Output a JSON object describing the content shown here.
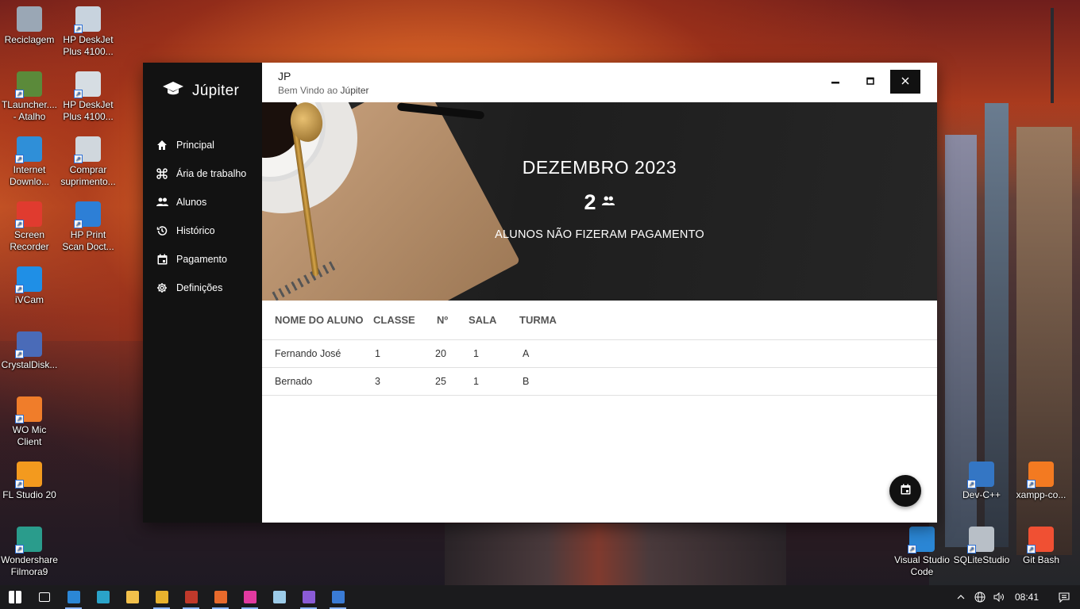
{
  "desktop": {
    "icons_left": [
      {
        "label": "Reciclagem",
        "icon": "recycle-bin-icon",
        "color": "#9aa7b5"
      },
      {
        "label": "HP DeskJet Plus 4100...",
        "icon": "printer-icon",
        "color": "#c8d3de"
      },
      {
        "label": "TLauncher.... - Atalho",
        "icon": "minecraft-block-icon",
        "color": "#5b8a3a"
      },
      {
        "label": "HP DeskJet Plus 4100...",
        "icon": "printer-icon",
        "color": "#d6dde3"
      },
      {
        "label": "Internet Downlo...",
        "icon": "globe-download-icon",
        "color": "#2f8fd8"
      },
      {
        "label": "Comprar suprimento...",
        "icon": "printer-cart-icon",
        "color": "#d0d7dd"
      },
      {
        "label": "Screen Recorder",
        "icon": "record-icon",
        "color": "#e03b2f"
      },
      {
        "label": "HP Print Scan Doct...",
        "icon": "scan-doctor-icon",
        "color": "#2d7fd6"
      },
      {
        "label": "iVCam",
        "icon": "webcam-icon",
        "color": "#1f8fe6"
      },
      {
        "label": "CrystalDisk...",
        "icon": "disk-icon",
        "color": "#4a6bb8"
      },
      {
        "label": "WO Mic Client",
        "icon": "microphone-icon",
        "color": "#f07d2a"
      },
      {
        "label": "FL Studio 20",
        "icon": "fruit-icon",
        "color": "#f39a1e"
      },
      {
        "label": "Wondershare Filmora9",
        "icon": "filmora-icon",
        "color": "#2a9c8c"
      }
    ],
    "icons_right": [
      {
        "label": "Dev-C++",
        "icon": "dev-cpp-icon",
        "color": "#3476c4"
      },
      {
        "label": "xampp-co...",
        "icon": "xampp-icon",
        "color": "#f37a21"
      },
      {
        "label": "Visual Studio Code",
        "icon": "vscode-icon",
        "color": "#2b87d6"
      },
      {
        "label": "SQLiteStudio",
        "icon": "database-icon",
        "color": "#b8bfc7"
      },
      {
        "label": "Git Bash",
        "icon": "git-icon",
        "color": "#f05033"
      }
    ]
  },
  "app": {
    "brand": "Júpiter",
    "window_title": "JP",
    "welcome_prefix": "Bem Vindo ao",
    "welcome_name": "Júpiter",
    "nav": [
      {
        "label": "Principal",
        "icon": "home-icon"
      },
      {
        "label": "Ária de trabalho",
        "icon": "command-icon"
      },
      {
        "label": "Alunos",
        "icon": "people-icon"
      },
      {
        "label": "Histórico",
        "icon": "history-icon"
      },
      {
        "label": "Pagamento",
        "icon": "calendar-icon"
      },
      {
        "label": "Definições",
        "icon": "settings-icon"
      }
    ],
    "hero": {
      "month": "DEZEMBRO 2023",
      "count": "2",
      "caption": "ALUNOS NÃO FIZERAM PAGAMENTO"
    },
    "table": {
      "headers": [
        "NOME DO ALUNO",
        "CLASSE",
        "Nº",
        "SALA",
        "TURMA"
      ],
      "rows": [
        [
          "Fernando José",
          "1",
          "20",
          "1",
          "A"
        ],
        [
          "Bernado",
          "3",
          "25",
          "1",
          "B"
        ]
      ]
    }
  },
  "taskbar": {
    "time": "08:41",
    "apps": [
      {
        "name": "start",
        "color": "#ffffff"
      },
      {
        "name": "task-view",
        "color": "#ffffff"
      },
      {
        "name": "vscode",
        "color": "#2b87d6"
      },
      {
        "name": "edge",
        "color": "#2aa3c9"
      },
      {
        "name": "file-explorer",
        "color": "#f2c04b"
      },
      {
        "name": "autocad",
        "color": "#e8b22e"
      },
      {
        "name": "access",
        "color": "#c0392b"
      },
      {
        "name": "stack",
        "color": "#e86a2c"
      },
      {
        "name": "app-pink",
        "color": "#e23aa0"
      },
      {
        "name": "notepad",
        "color": "#9ccbe8"
      },
      {
        "name": "visual-studio",
        "color": "#8a5bd6"
      },
      {
        "name": "app-running",
        "color": "#3a7bd5"
      }
    ]
  }
}
